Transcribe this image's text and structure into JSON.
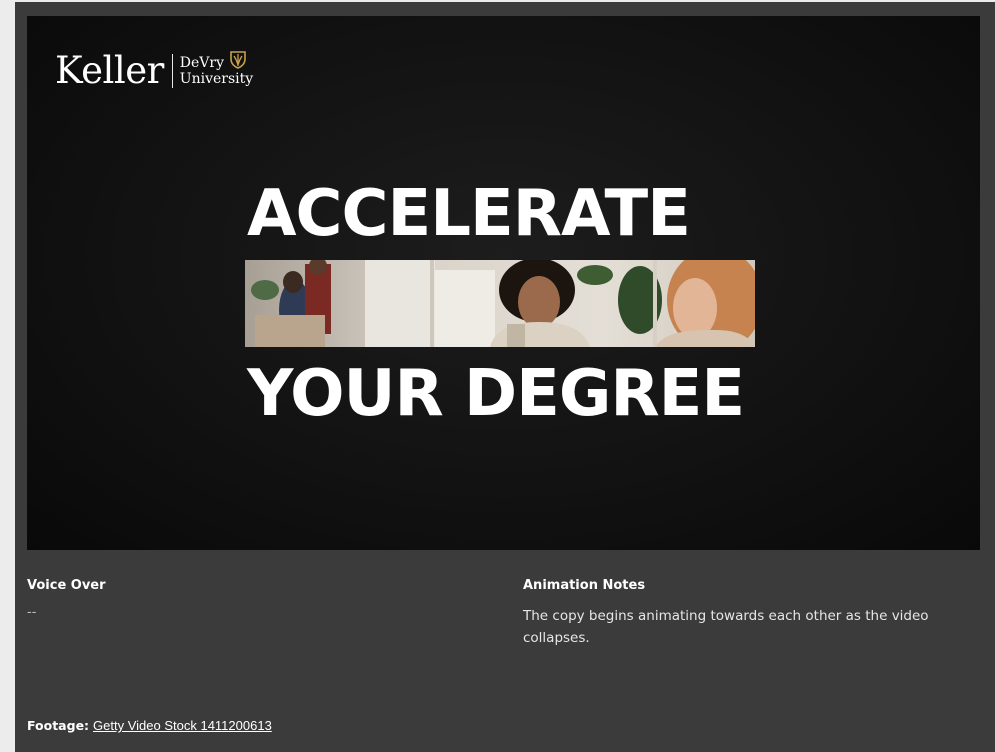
{
  "logo": {
    "brand": "Keller",
    "sub_line1": "DeVry",
    "sub_line2": "University"
  },
  "slide": {
    "headline_line1": "ACCELERATE",
    "headline_line2": "YOUR DEGREE"
  },
  "voice_over": {
    "label": "Voice Over",
    "value": "--"
  },
  "animation_notes": {
    "label": "Animation Notes",
    "text": "The copy begins animating towards each other as the video collapses."
  },
  "footage": {
    "label": "Footage:",
    "link_text": "Getty Video Stock 1411200613"
  },
  "colors": {
    "panel_bg": "#3b3b3b",
    "slide_bg": "#121212",
    "text": "#ffffff",
    "shield_gold": "#c8a24a"
  },
  "icons": [
    "devry-shield-icon"
  ]
}
